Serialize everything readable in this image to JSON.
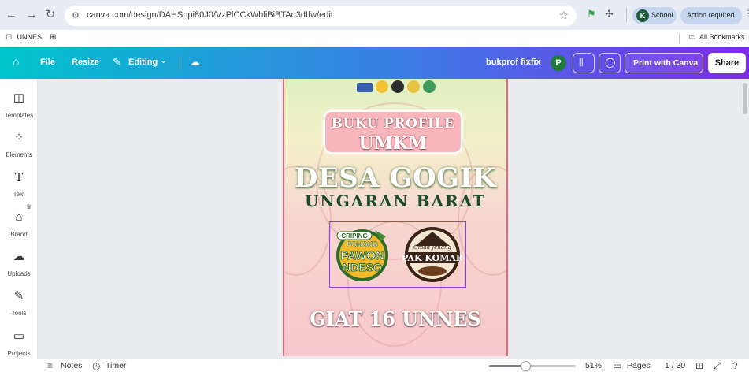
{
  "browser": {
    "url_host": "canva.com",
    "url_path": "/design/DAHSppi80J0/VzPlCCkWhliBiBTAd3dIfw/edit",
    "profile_initial": "K",
    "profile_label": "School",
    "action_chip": "Action required",
    "icons": [
      "back-arrow-icon",
      "forward-arrow-icon",
      "reload-icon",
      "star-icon",
      "extension-icon",
      "puzzle-icon",
      "more-icon"
    ]
  },
  "bookmarks": {
    "folder_label": "UNNES",
    "all_bookmarks": "All Bookmarks"
  },
  "canva_header": {
    "file": "File",
    "resize": "Resize",
    "editing": "Editing",
    "design_name": "bukprof fixfix",
    "avatar_initial": "P",
    "print_label": "Print with Canva",
    "share_label": "Share"
  },
  "sidebar": {
    "items": [
      {
        "label": "Templates",
        "icon": "templates-icon"
      },
      {
        "label": "Elements",
        "icon": "elements-icon"
      },
      {
        "label": "Text",
        "icon": "text-icon"
      },
      {
        "label": "Brand",
        "icon": "brand-icon"
      },
      {
        "label": "Uploads",
        "icon": "uploads-icon"
      },
      {
        "label": "Tools",
        "icon": "tools-icon"
      },
      {
        "label": "Projects",
        "icon": "projects-icon"
      }
    ]
  },
  "design": {
    "title_line1": "BUKU PROFILE",
    "title_line2": "UMKM",
    "village": "DESA GOGIK",
    "district": "UNGARAN BARAT",
    "badge1_line1": "CRIPING",
    "badge1_line2": "POHONG",
    "badge1_line3": "PAWON",
    "badge1_line4": "NDESO",
    "badge2_line1": "Omah Jenang",
    "badge2_line2": "PAK KOMAR",
    "footer": "GIAT 16 UNNES",
    "colors": {
      "accent": "#8b3dff",
      "border": "#e8647a",
      "dark_green": "#1c4b2b"
    }
  },
  "bottom_bar": {
    "notes": "Notes",
    "timer": "Timer",
    "zoom": "51%",
    "zoom_level": 0.51,
    "pages_label": "Pages",
    "page_count": "1 / 30"
  }
}
